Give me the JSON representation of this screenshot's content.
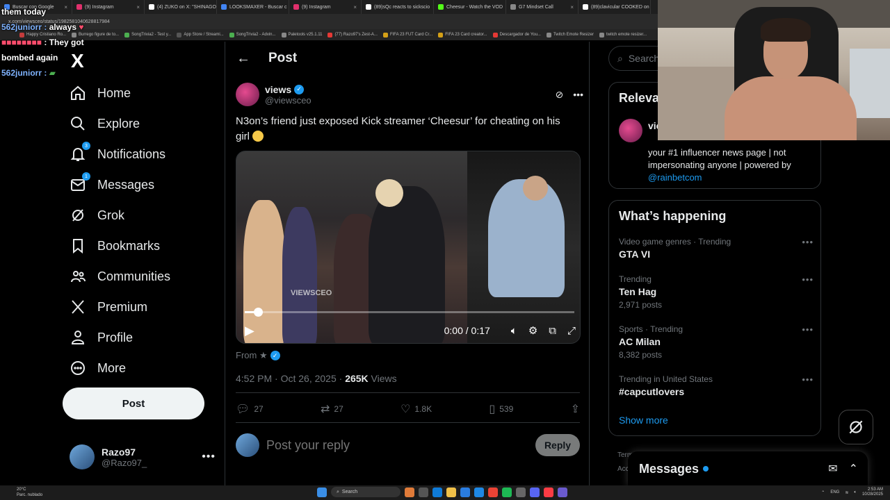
{
  "browser": {
    "tabs": [
      {
        "label": "Buscar con Google",
        "color": "#4285f4"
      },
      {
        "label": "(9) Instagram",
        "color": "#e1306c"
      },
      {
        "label": "(4) ZUKO on X: \"SHINAGO",
        "color": "#ffffff"
      },
      {
        "label": "LOOKSMAXER - Buscar c",
        "color": "#4285f4"
      },
      {
        "label": "(9) Instagram",
        "color": "#e1306c"
      },
      {
        "label": "(89)sQc reacts to sickscio",
        "color": "#ffffff"
      },
      {
        "label": "Cheesur - Watch the VOD",
        "color": "#53fc18"
      },
      {
        "label": "G7 Mindset Call",
        "color": "#888888"
      },
      {
        "label": "(89)clavicular COOKED on",
        "color": "#ffffff"
      }
    ],
    "url": "x.com/viewsceo/status/1982581040628817984",
    "bookmarks": [
      "Happy Cristiano Ro...",
      "Burrego figure de to...",
      "SongTrivia2 - Test y...",
      "App Store / Streami...",
      "SongTrivia2 - Advin...",
      "Paletools v25.1.11",
      "(77) Razo97's Zest-A...",
      "FIFA 23 FUT Card Cr...",
      "FIFA 23 Card creator...",
      "Descargador de You...",
      "Twitch Emote Resizer",
      "twitch emote resizer..."
    ]
  },
  "chat": {
    "lines": [
      {
        "user": "",
        "text": "them today"
      },
      {
        "user": "562juniorr :",
        "text": "always"
      },
      {
        "user": "",
        "text": "They got"
      },
      {
        "user": "",
        "text": "bombed again"
      },
      {
        "user": "562juniorr :",
        "text": ""
      }
    ]
  },
  "nav": {
    "logo": "X",
    "items": [
      {
        "label": "Home",
        "icon": "home-icon"
      },
      {
        "label": "Explore",
        "icon": "search-icon"
      },
      {
        "label": "Notifications",
        "icon": "bell-icon",
        "badge": "3"
      },
      {
        "label": "Messages",
        "icon": "mail-icon",
        "badge": "1"
      },
      {
        "label": "Grok",
        "icon": "grok-icon"
      },
      {
        "label": "Bookmarks",
        "icon": "bookmark-icon"
      },
      {
        "label": "Communities",
        "icon": "communities-icon"
      },
      {
        "label": "Premium",
        "icon": "x-premium-icon"
      },
      {
        "label": "Profile",
        "icon": "profile-icon"
      },
      {
        "label": "More",
        "icon": "more-circle-icon"
      }
    ],
    "post_label": "Post",
    "account": {
      "name": "Razo97",
      "handle": "@Razo97_"
    }
  },
  "main": {
    "title": "Post",
    "tweet": {
      "name": "views",
      "handle": "@viewsceo",
      "text": "N3on’s friend just exposed Kick streamer ‘Cheesur’ for cheating on his girl",
      "video": {
        "watermark": "VIEWSCEO",
        "time": "0:00 / 0:17",
        "progress": 0.04
      },
      "from": "From ★",
      "timestamp": "4:52 PM · Oct 26, 2025 · ",
      "views_count": "265K",
      "views_label": " Views",
      "stats": {
        "replies": "27",
        "reposts": "27",
        "likes": "1.8K",
        "bookmarks": "539"
      }
    },
    "reply": {
      "placeholder": "Post your reply",
      "button": "Reply"
    }
  },
  "sidebar": {
    "search_placeholder": "Search",
    "relevant": {
      "heading": "Relevant people",
      "name": "views",
      "handle": "@v",
      "bio": "your #1 influencer news page | not impersonating anyone | powered by ",
      "bio_link": "@rainbetcom"
    },
    "happening": {
      "heading": "What’s happening",
      "trends": [
        {
          "context": "Video game genres · Trending",
          "name": "GTA VI",
          "count": ""
        },
        {
          "context": "Trending",
          "name": "Ten Hag",
          "count": "2,971 posts"
        },
        {
          "context": "Sports · Trending",
          "name": "AC Milan",
          "count": "8,382 posts"
        },
        {
          "context": "Trending in United States",
          "name": "#capcutlovers",
          "count": ""
        }
      ],
      "show_more": "Show more"
    },
    "terms": "Terms",
    "terms2": "Acc",
    "messages_label": "Messages"
  },
  "taskbar": {
    "weather_temp": "20°C",
    "weather_desc": "Parc. nublado",
    "search": "Search",
    "lang": "ENG",
    "time": "2:53 AM",
    "date": "10/28/2025"
  }
}
